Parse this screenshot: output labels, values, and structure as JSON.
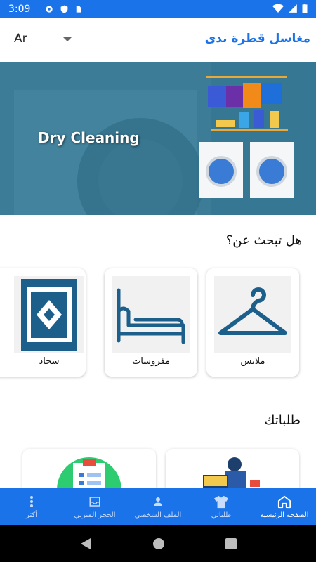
{
  "status_bar": {
    "time": "3:09"
  },
  "app_bar": {
    "language": "Ar",
    "title": "مغاسل قطرة ندى"
  },
  "banner": {
    "text": "Dry Cleaning"
  },
  "search_section": {
    "title": "هل تبحث عن؟"
  },
  "categories": [
    {
      "label": "ملابس",
      "icon": "hanger-icon"
    },
    {
      "label": "مفروشات",
      "icon": "bed-icon"
    },
    {
      "label": "سجاد",
      "icon": "carpet-icon"
    }
  ],
  "orders_section": {
    "title": "طلباتك"
  },
  "bottom_nav": [
    {
      "label": "الصفحة الرئيسية",
      "icon": "home-icon",
      "active": true
    },
    {
      "label": "طلباتي",
      "icon": "shirt-icon",
      "active": false
    },
    {
      "label": "الملف الشخصي",
      "icon": "person-icon",
      "active": false
    },
    {
      "label": "الحجز المنزلي",
      "icon": "inbox-icon",
      "active": false
    },
    {
      "label": "أكثر",
      "icon": "more-vert-icon",
      "active": false
    }
  ],
  "colors": {
    "primary": "#1a73e8",
    "banner": "#3d7c96",
    "icon_blue": "#1c5f8a"
  }
}
